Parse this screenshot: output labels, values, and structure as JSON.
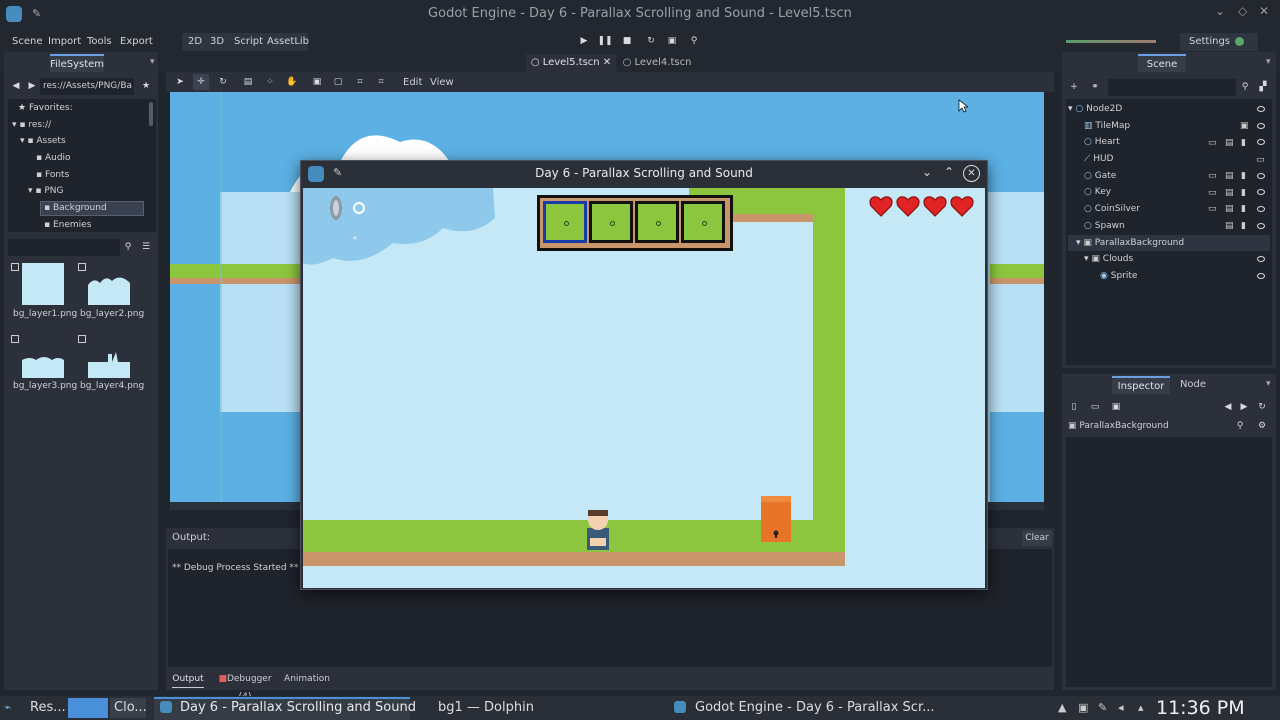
{
  "window_title": "Godot Engine - Day 6 - Parallax Scrolling and Sound - Level5.tscn",
  "menu": [
    "Scene",
    "Import",
    "Tools",
    "Export"
  ],
  "workspaces": [
    "2D",
    "3D",
    "Script",
    "AssetLib"
  ],
  "settings_label": "Settings",
  "filesystem": {
    "tab": "FileSystem",
    "path": "res://Assets/PNG/Ba",
    "tree": [
      "Favorites:",
      "res://",
      "Assets",
      "Audio",
      "Fonts",
      "PNG",
      "Background",
      "Enemies"
    ],
    "files": [
      "bg_layer1.png",
      "bg_layer2.png",
      "bg_layer3.png",
      "bg_layer4.png"
    ]
  },
  "scene_tabs": [
    "Level5.tscn",
    "Level4.tscn"
  ],
  "viewport_menu": [
    "Edit",
    "View"
  ],
  "scene_panel": {
    "tab": "Scene",
    "nodes": [
      "Node2D",
      "TileMap",
      "Heart",
      "HUD",
      "Gate",
      "Key",
      "CoinSilver",
      "Spawn",
      "ParallaxBackground",
      "Clouds",
      "Sprite"
    ]
  },
  "inspector": {
    "tabs": [
      "Inspector",
      "Node"
    ],
    "object": "ParallaxBackground"
  },
  "output": {
    "label": "Output:",
    "clear": "Clear",
    "log": "** Debug Process Started **",
    "tabs": [
      "Output",
      "Debugger (4)",
      "Animation"
    ]
  },
  "game_window": {
    "title": "Day 6 - Parallax Scrolling and Sound",
    "hearts": 4,
    "slots": 4
  },
  "taskbar": {
    "items": [
      "Res...",
      "Clo...",
      "Day 6 - Parallax Scrolling and Sound",
      "bg1 — Dolphin",
      "Godot Engine - Day 6 - Parallax Scr..."
    ],
    "clock": "11:36 PM"
  }
}
